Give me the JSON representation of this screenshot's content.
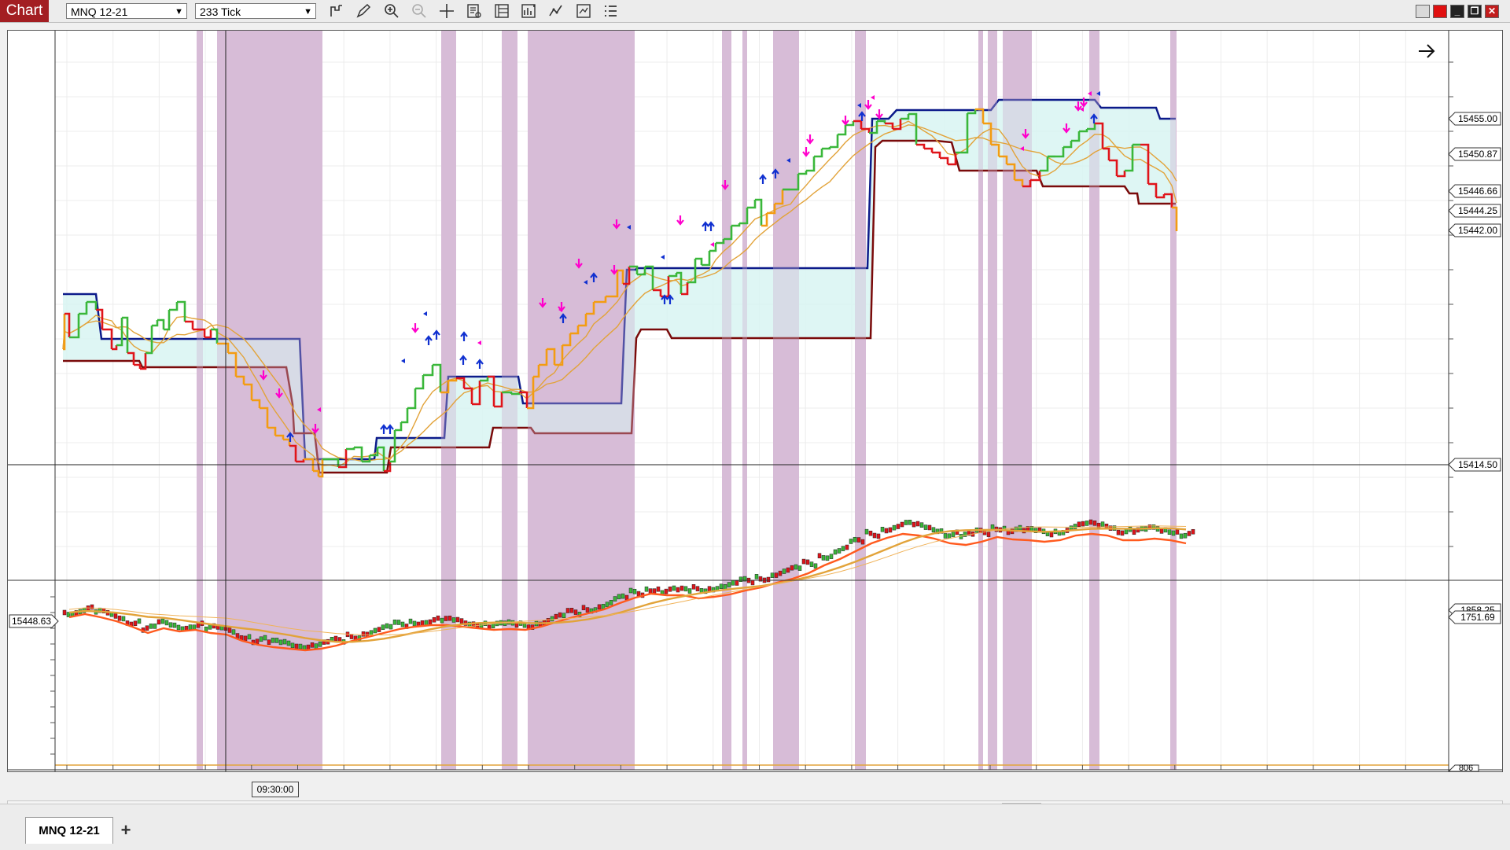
{
  "toolbar": {
    "chart_tab_label": "Chart",
    "instrument_value": "MNQ 12-21",
    "interval_value": "233 Tick",
    "tools": [
      "bar-type-icon",
      "draw-pencil-icon",
      "zoom-in-icon",
      "zoom-out-icon",
      "crosshair-icon",
      "data-box-icon",
      "properties-icon",
      "strategies-icon",
      "indicators-icon",
      "chart-trader-icon",
      "list-icon"
    ]
  },
  "price_panel": {
    "price_labels": [
      "15455.00",
      "15450.87",
      "15446.66",
      "15444.25",
      "15442.00",
      "15414.50"
    ]
  },
  "indicator_panel": {
    "value_labels": [
      "1858.25",
      "1751.69",
      "806"
    ],
    "crosshair_label": "15448.63"
  },
  "time_axis": {
    "crosshair_time": "09:30:00"
  },
  "tabs": {
    "instrument_tab": "MNQ 12-21",
    "add_tab": "+"
  },
  "colors": {
    "up": "#3ab73a",
    "down": "#e0141a",
    "neutral": "#f39c12",
    "channel_upper": "#0c1a8a",
    "channel_lower": "#7a0a0a",
    "channel_fill": "#d8f4f2",
    "session_band": "#d7bcd8",
    "ma": "#e2a33a",
    "arrow_up": "#1030d0",
    "arrow_down": "#ff00cc",
    "chart_tab": "#a31e22"
  }
}
